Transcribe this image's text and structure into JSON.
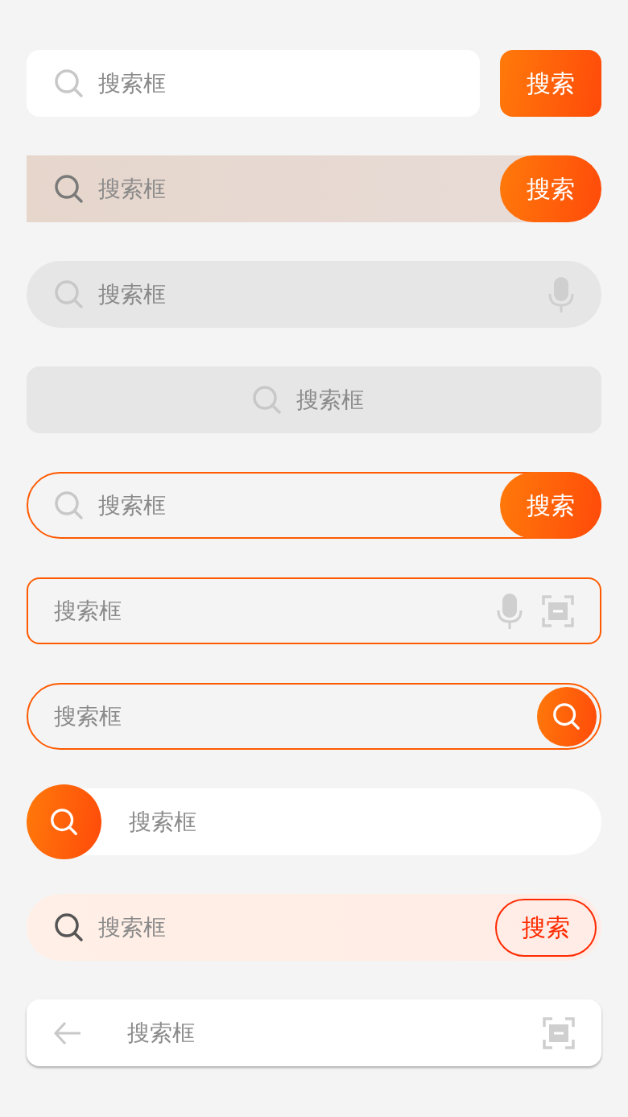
{
  "search_bars": [
    {
      "kind": "white-separate-button",
      "placeholder": "搜索框",
      "button": "搜索"
    },
    {
      "kind": "tinted-attached-button",
      "placeholder": "搜索框",
      "button": "搜索"
    },
    {
      "kind": "grey-mic",
      "placeholder": "搜索框"
    },
    {
      "kind": "grey-centered",
      "placeholder": "搜索框"
    },
    {
      "kind": "outline-attached-button",
      "placeholder": "搜索框",
      "button": "搜索"
    },
    {
      "kind": "outline-mic-scan",
      "placeholder": "搜索框"
    },
    {
      "kind": "outline-round-search",
      "placeholder": "搜索框"
    },
    {
      "kind": "white-left-circle",
      "placeholder": "搜索框"
    },
    {
      "kind": "peach-outline-button",
      "placeholder": "搜索框",
      "button": "搜索"
    },
    {
      "kind": "white-back-scan",
      "placeholder": "搜索框"
    }
  ]
}
